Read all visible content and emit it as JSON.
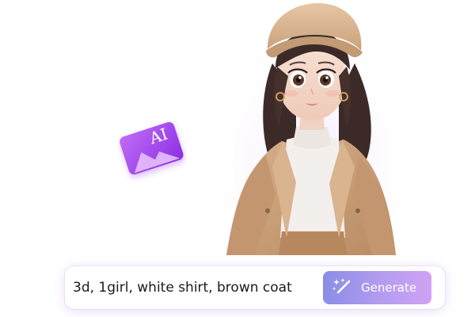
{
  "prompt": {
    "value": "3d, 1girl, white shirt, brown coat"
  },
  "generate_button": {
    "label": "Generate",
    "icon": "magic-wand-icon"
  },
  "badge": {
    "text": "AI",
    "icon": "ai-image-icon",
    "color": "#9b4cf0"
  },
  "illustration": {
    "subject": "3d-girl-character"
  },
  "colors": {
    "accent_start": "#8a8de6",
    "accent_end": "#cfa2f3",
    "coat": "#c9a27c",
    "shirt": "#f3efec"
  }
}
